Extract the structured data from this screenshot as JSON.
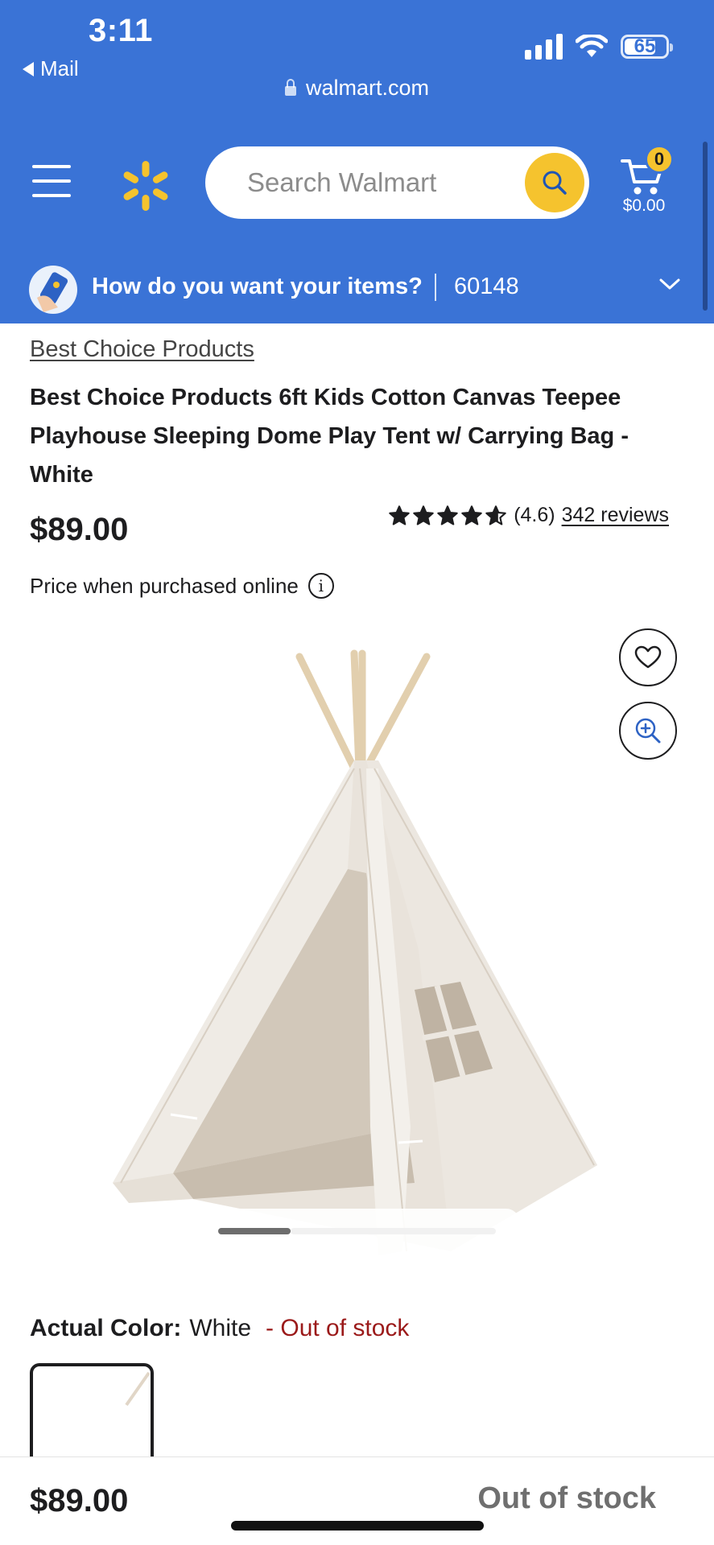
{
  "status_bar": {
    "time": "3:11",
    "back_app": "Mail",
    "battery": "65"
  },
  "browser": {
    "url": "walmart.com"
  },
  "header": {
    "search_placeholder": "Search Walmart",
    "cart_count": "0",
    "cart_total": "$0.00"
  },
  "fulfillment": {
    "prompt": "How do you want your items?",
    "zip": "60148"
  },
  "product": {
    "brand": "Best Choice Products",
    "title": "Best Choice Products 6ft Kids Cotton Canvas Teepee Playhouse Sleeping Dome Play Tent w/ Carrying Bag - White",
    "price": "$89.00",
    "rating_value": 4.6,
    "rating_text": "(4.6)",
    "reviews_text": "342 reviews",
    "price_note": "Price when purchased online",
    "info_glyph": "i"
  },
  "variant": {
    "label": "Actual Color:",
    "value": "White",
    "availability": "- Out of stock"
  },
  "bottom_bar": {
    "price": "$89.00",
    "status": "Out of stock"
  },
  "colors": {
    "brand_blue": "#3a73d6",
    "spark_yellow": "#f5c32e",
    "out_of_stock_red": "#9b1a1a"
  },
  "icons": [
    "back-triangle-icon",
    "signal-icon",
    "wifi-icon",
    "battery-icon",
    "lock-icon",
    "menu-icon",
    "walmart-spark-icon",
    "search-icon",
    "cart-icon",
    "fulfillment-icon",
    "chevron-down-icon",
    "star-icon",
    "info-icon",
    "heart-icon",
    "zoom-in-icon"
  ]
}
